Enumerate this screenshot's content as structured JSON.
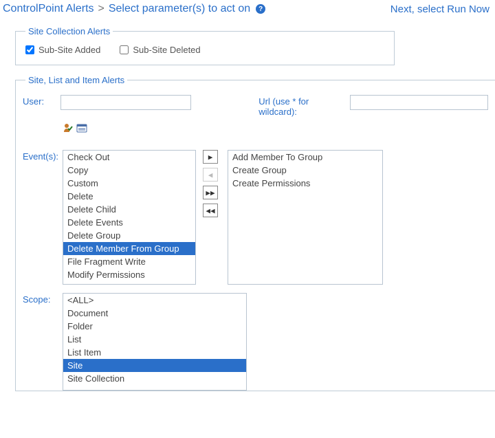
{
  "header": {
    "title": "ControlPoint Alerts",
    "subtitle": "Select parameter(s) to act on",
    "run_now": "Next, select Run Now "
  },
  "site_collection_alerts": {
    "legend": "Site Collection Alerts",
    "sub_site_added": {
      "label": "Sub-Site Added",
      "checked": true
    },
    "sub_site_deleted": {
      "label": "Sub-Site Deleted",
      "checked": false
    }
  },
  "site_alerts": {
    "legend": "Site, List and Item Alerts",
    "user_label": "User:",
    "url_label": "Url (use * for wildcard):",
    "user_value": "",
    "url_value": "",
    "events_label": "Event(s):",
    "available_events": [
      "Check Out",
      "Copy",
      "Custom",
      "Delete",
      "Delete Child",
      "Delete Events",
      "Delete Group",
      "Delete Member From Group",
      "File Fragment Write",
      "Modify Permissions"
    ],
    "available_selected_index": 7,
    "selected_events": [
      "Add Member To Group",
      "Create Group",
      "Create Permissions"
    ],
    "scope_label": "Scope:",
    "scope_options": [
      "<ALL>",
      "Document",
      "Folder",
      "List",
      "List Item",
      "Site",
      "Site Collection"
    ],
    "scope_selected_index": 5
  }
}
